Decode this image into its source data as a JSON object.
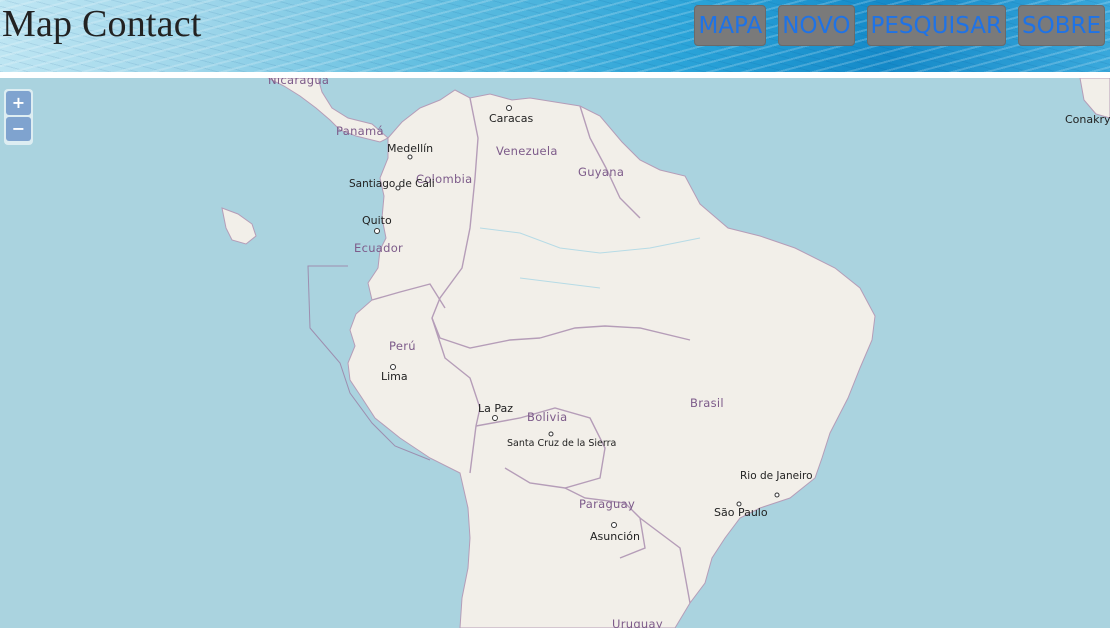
{
  "header": {
    "title": "Map Contact",
    "nav": [
      "MAPA",
      "NOVO",
      "PESQUISAR",
      "SOBRE"
    ]
  },
  "map": {
    "zoom_in": "+",
    "zoom_out": "−",
    "countries": [
      "Nicaragua",
      "Panamá",
      "Venezuela",
      "Colombia",
      "Guyana",
      "Ecuador",
      "Perú",
      "Bolivia",
      "Brasil",
      "Paraguay",
      "Uruguay"
    ],
    "cities": [
      "Caracas",
      "Medellín",
      "Santiago de Cali",
      "Quito",
      "Lima",
      "La Paz",
      "Santa Cruz de la Sierra",
      "Rio de Janeiro",
      "São Paulo",
      "Asunción",
      "Conakry"
    ],
    "colors": {
      "water": "#aad3df",
      "land": "#f2efe9",
      "border": "#b59db8",
      "accent": "#1f73e6"
    }
  }
}
